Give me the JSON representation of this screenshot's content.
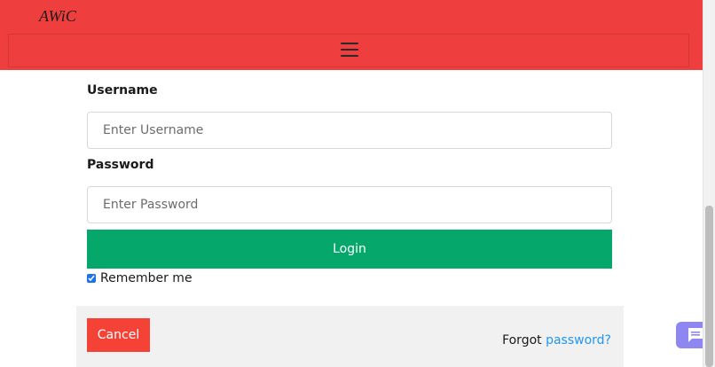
{
  "header": {
    "brand": "AWiC"
  },
  "form": {
    "username_label": "Username",
    "username_placeholder": "Enter Username",
    "username_value": "",
    "password_label": "Password",
    "password_placeholder": "Enter Password",
    "password_value": "",
    "login_label": "Login",
    "remember_label": "Remember me",
    "remember_checked": true
  },
  "footer": {
    "cancel_label": "Cancel",
    "forgot_prefix": "Forgot",
    "forgot_link": "password?"
  },
  "chat": {
    "icon": "chat-icon"
  },
  "colors": {
    "header_bg": "#ef3e3e",
    "login_bg": "#05a86a",
    "cancel_bg": "#f44336",
    "link": "#2196f3",
    "chat_bg": "#8f87f1"
  }
}
